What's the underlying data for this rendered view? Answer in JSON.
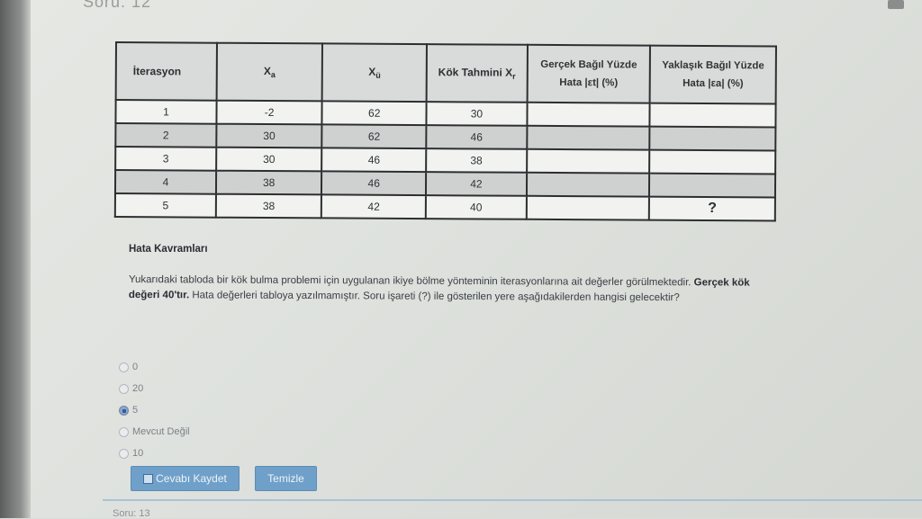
{
  "question": {
    "title": "Soru: 12",
    "next_title": "Soru: 13"
  },
  "table": {
    "headers": {
      "iteration": "İterasyon",
      "xa": "X",
      "xa_sub": "a",
      "xu": "X",
      "xu_sub": "ü",
      "root": "Kök Tahmini X",
      "root_sub": "r",
      "true_err_line1": "Gerçek Bağıl Yüzde",
      "true_err_line2": "Hata |εt| (%)",
      "approx_err_line1": "Yaklaşık Bağıl Yüzde",
      "approx_err_line2": "Hata |εa| (%)"
    },
    "rows": [
      {
        "it": "1",
        "xa": "-2",
        "xu": "62",
        "xr": "30",
        "et": "",
        "ea": ""
      },
      {
        "it": "2",
        "xa": "30",
        "xu": "62",
        "xr": "46",
        "et": "",
        "ea": ""
      },
      {
        "it": "3",
        "xa": "30",
        "xu": "46",
        "xr": "38",
        "et": "",
        "ea": ""
      },
      {
        "it": "4",
        "xa": "38",
        "xu": "46",
        "xr": "42",
        "et": "",
        "ea": ""
      },
      {
        "it": "5",
        "xa": "38",
        "xu": "42",
        "xr": "40",
        "et": "",
        "ea": "?"
      }
    ]
  },
  "section": {
    "title": "Hata Kavramları",
    "text_part1": "Yukarıdaki tabloda bir kök bulma problemi için uygulanan ikiye bölme yönteminin iterasyonlarına ait değerler görülmektedir. ",
    "text_bold": "Gerçek kök değeri 40'tır.",
    "text_part2": " Hata değerleri tabloya yazılmamıştır. Soru işareti (?) ile gösterilen yere aşağıdakilerden hangisi gelecektir?"
  },
  "options": [
    {
      "label": "0",
      "checked": false
    },
    {
      "label": "20",
      "checked": false
    },
    {
      "label": "5",
      "checked": true
    },
    {
      "label": "Mevcut Değil",
      "checked": false
    },
    {
      "label": "10",
      "checked": false
    }
  ],
  "buttons": {
    "save": "Cevabı Kaydet",
    "clear": "Temizle"
  }
}
